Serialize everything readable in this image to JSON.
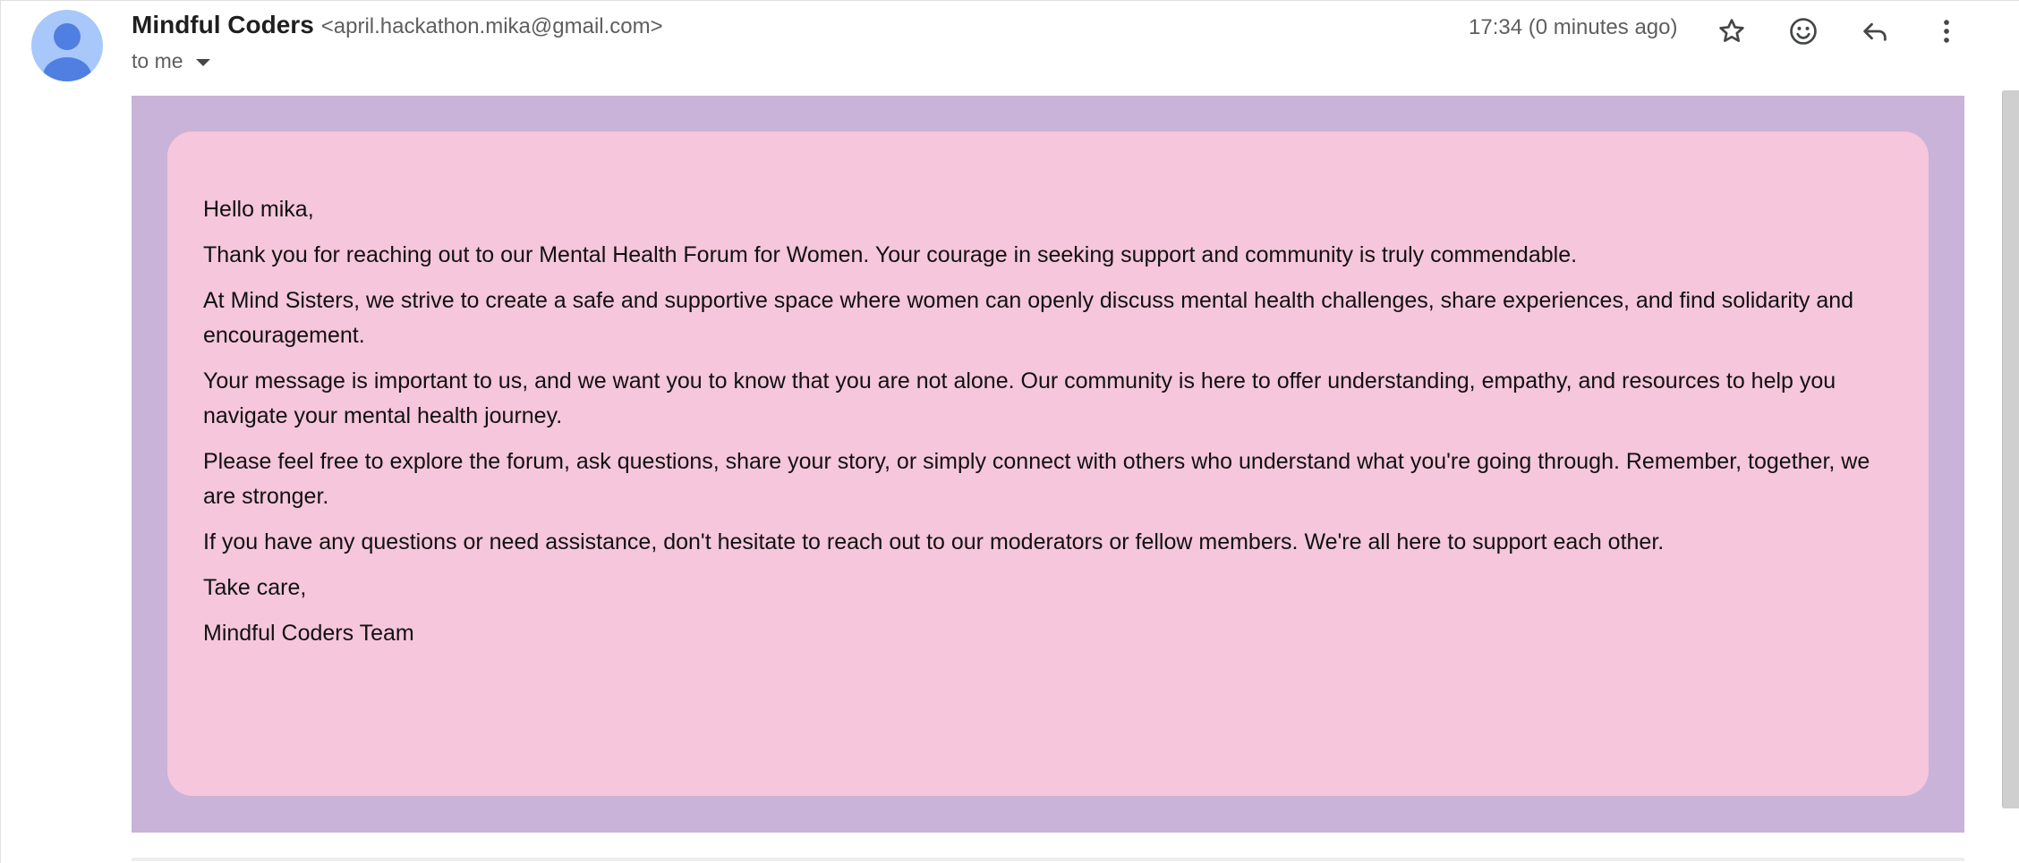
{
  "message": {
    "sender_name": "Mindful Coders",
    "sender_email": "<april.hackathon.mika@gmail.com>",
    "recipient": "to me",
    "timestamp": "17:34 (0 minutes ago)"
  },
  "actions": {
    "star_icon": "star-icon",
    "emoji_icon": "emoji-icon",
    "reply_icon": "reply-icon",
    "more_icon": "more-vert-icon"
  },
  "colors": {
    "outer_background": "#c9b3d9",
    "card_background": "#f5c6dc",
    "avatar_background": "#a8c7fa",
    "avatar_figure": "#4f7fe0"
  },
  "body": {
    "paragraphs": [
      "Hello mika,",
      "Thank you for reaching out to our Mental Health Forum for Women. Your courage in seeking support and community is truly commendable.",
      "At Mind Sisters, we strive to create a safe and supportive space where women can openly discuss mental health challenges, share experiences, and find solidarity and encouragement.",
      "Your message is important to us, and we want you to know that you are not alone. Our community is here to offer understanding, empathy, and resources to help you navigate your mental health journey.",
      "Please feel free to explore the forum, ask questions, share your story, or simply connect with others who understand what you're going through. Remember, together, we are stronger.",
      "If you have any questions or need assistance, don't hesitate to reach out to our moderators or fellow members. We're all here to support each other.",
      "Take care,",
      "Mindful Coders Team"
    ]
  }
}
